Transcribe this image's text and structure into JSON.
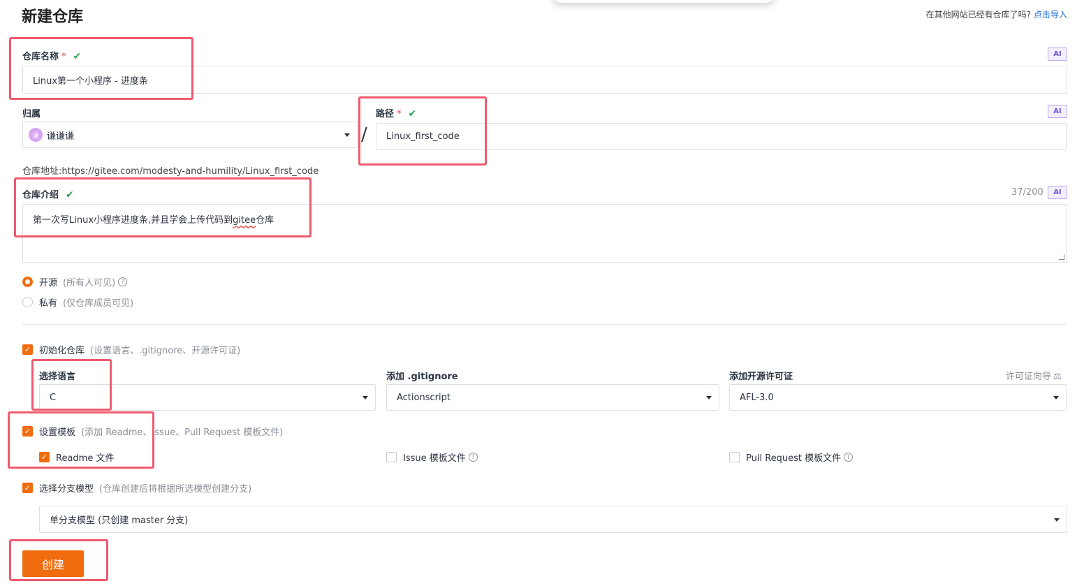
{
  "header": {
    "title": "新建仓库",
    "import_question": "在其他网站已经有仓库了吗?",
    "import_link": "点击导入"
  },
  "repo_name": {
    "label": "仓库名称",
    "required_mark": "*",
    "valid_mark": "✔",
    "value": "Linux第一个小程序 - 进度条",
    "ai_label": "AI"
  },
  "owner": {
    "label": "归属",
    "avatar_text": "谦",
    "value": "谦谦谦"
  },
  "separator": "/",
  "path": {
    "label": "路径",
    "required_mark": "*",
    "valid_mark": "✔",
    "value": "Linux_first_code",
    "ai_label": "AI"
  },
  "repo_address": {
    "label": "仓库地址:",
    "url": "https://gitee.com/modesty-and-humility/Linux_first_code"
  },
  "description": {
    "label": "仓库介绍",
    "valid_mark": "✔",
    "value_before": "第一次写Linux小程序进度条,并且学会上传代码到",
    "value_misspelled": "gitee",
    "value_after": "仓库",
    "counter": "37/200",
    "ai_label": "AI"
  },
  "visibility": {
    "options": [
      {
        "label": "开源",
        "hint": "(所有人可见)",
        "selected": true
      },
      {
        "label": "私有",
        "hint": "(仅仓库成员可见)",
        "selected": false
      }
    ]
  },
  "init_repo": {
    "label": "初始化仓库",
    "hint": "(设置语言、.gitignore、开源许可证)",
    "checked": true,
    "language": {
      "label": "选择语言",
      "value": "C"
    },
    "gitignore": {
      "label": "添加 .gitignore",
      "value": "Actionscript"
    },
    "license": {
      "label": "添加开源许可证",
      "value": "AFL-3.0",
      "guide": "许可证向导",
      "guide_icon": "⚖"
    }
  },
  "templates": {
    "label": "设置模板",
    "hint": "(添加 Readme、Issue、Pull Request 模板文件)",
    "checked": true,
    "items": [
      {
        "label": "Readme 文件",
        "checked": true
      },
      {
        "label": "Issue 模板文件",
        "checked": false
      },
      {
        "label": "Pull Request 模板文件",
        "checked": false
      }
    ]
  },
  "branch_model": {
    "label": "选择分支模型",
    "hint": "(仓库创建后将根据所选模型创建分支)",
    "checked": true,
    "value": "单分支模型 (只创建 master 分支)"
  },
  "create_button": "创建",
  "colors": {
    "accent": "#f06c0f",
    "annotation_box": "#ef5a6f",
    "valid": "#2ea44f",
    "link": "#1b6fd8"
  }
}
